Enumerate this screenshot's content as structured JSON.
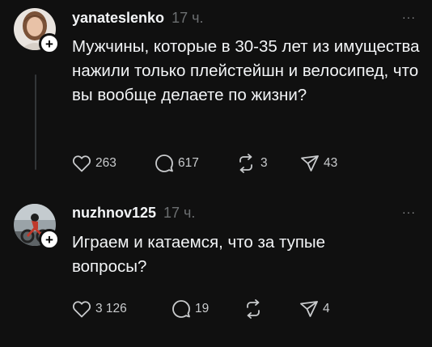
{
  "posts": [
    {
      "username": "yanateslenko",
      "timestamp": "17 ч.",
      "text": "Мужчины, которые в 30-35 лет из имущества нажили только плейстейшн и велосипед, что вы вообще делаете по жизни?",
      "actions": {
        "likes": "263",
        "comments": "617",
        "reposts": "3",
        "shares": "43"
      },
      "follow_label": "+",
      "more_label": "···"
    },
    {
      "username": "nuzhnov125",
      "timestamp": "17 ч.",
      "text": "Играем и катаемся, что за тупые вопросы?",
      "actions": {
        "likes": "3 126",
        "comments": "19",
        "reposts": "",
        "shares": "4"
      },
      "follow_label": "+",
      "more_label": "···"
    }
  ],
  "icons": {
    "like": "heart-icon",
    "comment": "comment-icon",
    "repost": "repost-icon",
    "share": "share-icon",
    "more": "more-options-icon",
    "follow": "follow-plus-icon"
  },
  "colors": {
    "background": "#101010",
    "primary_text": "#f3f5f7",
    "secondary_text": "#6c6f71",
    "thread_line": "#333638"
  }
}
